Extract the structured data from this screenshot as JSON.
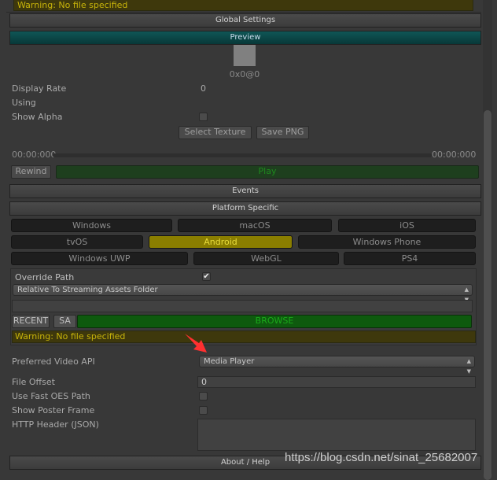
{
  "top_warning": {
    "text": "Warning: No file specified"
  },
  "sections": {
    "global_settings": "Global Settings",
    "preview": "Preview",
    "events": "Events",
    "platform_specific": "Platform Specific",
    "about_help": "About / Help"
  },
  "preview": {
    "resolution": "0x0@0",
    "display_rate_label": "Display Rate",
    "display_rate_value": "0",
    "using_label": "Using",
    "show_alpha_label": "Show Alpha",
    "show_alpha": false,
    "select_texture": "Select Texture",
    "save_png": "Save PNG",
    "time_start": "00:00:000",
    "time_end": "00:00:000",
    "rewind": "Rewind",
    "play": "Play"
  },
  "platforms": [
    [
      {
        "label": "Windows"
      },
      {
        "label": "macOS"
      },
      {
        "label": "iOS"
      }
    ],
    [
      {
        "label": "tvOS"
      },
      {
        "label": "Android",
        "selected": true
      },
      {
        "label": "Windows Phone"
      }
    ],
    [
      {
        "label": "Windows UWP"
      },
      {
        "label": "WebGL"
      },
      {
        "label": "PS4"
      }
    ]
  ],
  "android": {
    "override_path_label": "Override Path",
    "override_path": true,
    "path_mode": "Relative To Streaming Assets Folder",
    "path_value": "",
    "recent": "RECENT",
    "sa": "SA",
    "browse": "BROWSE",
    "warning": "Warning: No file specified",
    "preferred_api_label": "Preferred Video API",
    "preferred_api": "Media Player",
    "file_offset_label": "File Offset",
    "file_offset": "0",
    "fast_oes_label": "Use Fast OES Path",
    "fast_oes": false,
    "poster_label": "Show Poster Frame",
    "poster": false,
    "http_header_label": "HTTP Header (JSON)",
    "http_header": ""
  },
  "watermark": "https://blog.csdn.net/sinat_25682007",
  "colors": {
    "preview_header": "#0d4848",
    "selected_platform": "#8a7e00",
    "play": "#1e3f1e",
    "browse": "#0e5a0e",
    "warning_bg": "#3e380c",
    "warning_text": "#c8b40a",
    "arrow": "#ff3030"
  }
}
